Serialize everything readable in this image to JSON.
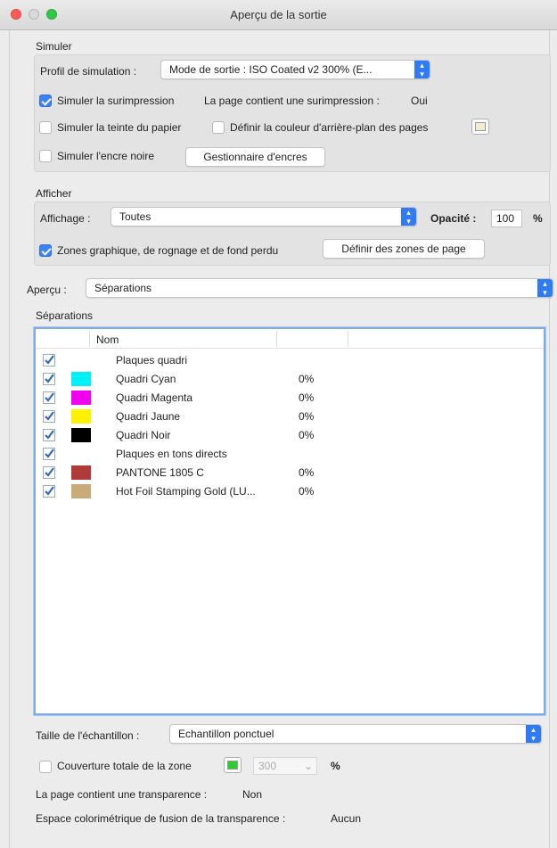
{
  "window": {
    "title": "Aperçu de la sortie"
  },
  "simuler": {
    "group_label": "Simuler",
    "profil_label": "Profil de simulation :",
    "profil_value": "Mode de sortie : ISO Coated v2 300% (E...",
    "surimpression_label": "Simuler la surimpression",
    "surimpression_checked": true,
    "page_surimpression_label": "La page contient une surimpression :",
    "page_surimpression_value": "Oui",
    "teinte_papier_label": "Simuler la teinte du papier",
    "teinte_papier_checked": false,
    "couleur_fond_label": "Définir la couleur d'arrière-plan des pages",
    "couleur_fond_checked": false,
    "couleur_fond_swatch": "#f2ecd2",
    "encre_noire_label": "Simuler l'encre noire",
    "encre_noire_checked": false,
    "gestionnaire_button": "Gestionnaire d'encres"
  },
  "afficher": {
    "group_label": "Afficher",
    "affichage_label": "Affichage :",
    "affichage_value": "Toutes",
    "opacite_label": "Opacité :",
    "opacite_value": "100",
    "opacite_unit": "%",
    "zones_label": "Zones graphique, de rognage et de fond perdu",
    "zones_checked": true,
    "definir_zones_button": "Définir des zones de page"
  },
  "apercu": {
    "label": "Aperçu :",
    "value": "Séparations"
  },
  "separations": {
    "group_label": "Séparations",
    "col_nom": "Nom",
    "rows": [
      {
        "checked": true,
        "color": "",
        "name": "Plaques quadri",
        "pct": ""
      },
      {
        "checked": true,
        "color": "#00f0f8",
        "name": "Quadri Cyan",
        "pct": "0%"
      },
      {
        "checked": true,
        "color": "#f000f0",
        "name": "Quadri Magenta",
        "pct": "0%"
      },
      {
        "checked": true,
        "color": "#fff200",
        "name": "Quadri Jaune",
        "pct": "0%"
      },
      {
        "checked": true,
        "color": "#000000",
        "name": "Quadri Noir",
        "pct": "0%"
      },
      {
        "checked": true,
        "color": "",
        "name": "Plaques en tons directs",
        "pct": ""
      },
      {
        "checked": true,
        "color": "#b03a3a",
        "name": "PANTONE 1805 C",
        "pct": "0%"
      },
      {
        "checked": true,
        "color": "#c9ab7a",
        "name": "Hot Foil Stamping Gold (LU...",
        "pct": "0%"
      }
    ]
  },
  "echantillon": {
    "label": "Taille de l'échantillon :",
    "value": "Echantillon ponctuel"
  },
  "couverture": {
    "label": "Couverture totale de la zone",
    "checked": false,
    "swatch": "#2ecc2e",
    "value": "300",
    "unit": "%"
  },
  "transparence": {
    "label": "La page contient une transparence :",
    "value": "Non"
  },
  "espace_fusion": {
    "label": "Espace colorimétrique de fusion de la transparence :",
    "value": "Aucun"
  }
}
